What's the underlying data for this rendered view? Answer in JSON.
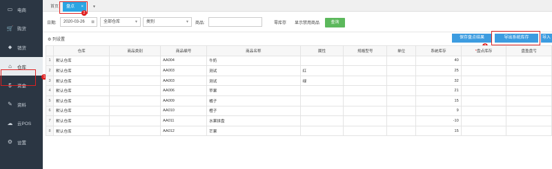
{
  "sidebar": {
    "items": [
      {
        "label": "电商",
        "icon": "monitor-icon",
        "glyph": "▭"
      },
      {
        "label": "购货",
        "icon": "cart-icon",
        "glyph": "🛒"
      },
      {
        "label": "销货",
        "icon": "tag-icon",
        "glyph": "⬥"
      },
      {
        "label": "仓库",
        "icon": "warehouse-icon",
        "glyph": "⌂"
      },
      {
        "label": "资金",
        "icon": "money-icon",
        "glyph": "$"
      },
      {
        "label": "资料",
        "icon": "pencil-icon",
        "glyph": "✎"
      },
      {
        "label": "云POS",
        "icon": "cloud-icon",
        "glyph": "☁"
      },
      {
        "label": "设置",
        "icon": "gear-icon",
        "glyph": "⚙"
      }
    ]
  },
  "tabs": {
    "home": "首页",
    "active": "盘点",
    "close": "×",
    "more": "▼"
  },
  "annotations": {
    "b1": "1",
    "b2": "2",
    "b3": "3"
  },
  "filter": {
    "date_label": "日期:",
    "date_value": "2020-03-26",
    "calendar_glyph": "▦",
    "warehouse_value": "全部仓库",
    "category_value": "类别",
    "dropdown_glyph": "▼",
    "product_label": "商品:",
    "product_value": "",
    "zero_stock": "零库存",
    "show_disabled": "显示禁用商品",
    "query_button": "查询"
  },
  "toolbar": {
    "column_settings": "⚙ 列设置",
    "save_button": "保存盘点结果",
    "export_button": "导出系统库存",
    "import_button": "导入"
  },
  "table": {
    "columns": [
      "",
      "仓库",
      "商品类别",
      "商品编号",
      "商品名称",
      "属性",
      "规格型号",
      "单位",
      "系统库存",
      "盘点库存",
      "盘盈盘亏"
    ],
    "required_mark": "*",
    "rows": [
      [
        "1",
        "默认仓库",
        "",
        "AA004",
        "牛奶",
        "",
        "",
        "",
        "40",
        "",
        ""
      ],
      [
        "2",
        "默认仓库",
        "",
        "AA003",
        "测试",
        "红",
        "",
        "",
        "25",
        "",
        ""
      ],
      [
        "3",
        "默认仓库",
        "",
        "AA003",
        "测试",
        "绿",
        "",
        "",
        "32",
        "",
        ""
      ],
      [
        "4",
        "默认仓库",
        "",
        "AA006",
        "苹果",
        "",
        "",
        "",
        "21",
        "",
        ""
      ],
      [
        "5",
        "默认仓库",
        "",
        "AA009",
        "橘子",
        "",
        "",
        "",
        "15",
        "",
        ""
      ],
      [
        "6",
        "默认仓库",
        "",
        "AA010",
        "橙子",
        "",
        "",
        "",
        "9",
        "",
        ""
      ],
      [
        "7",
        "默认仓库",
        "",
        "AA011",
        "水果拼盘",
        "",
        "",
        "",
        "-10",
        "",
        ""
      ],
      [
        "8",
        "默认仓库",
        "",
        "AA012",
        "芒果",
        "",
        "",
        "",
        "15",
        "",
        ""
      ]
    ]
  },
  "colors": {
    "sidebar": "#2b3643",
    "accent": "#2aa5e3",
    "button": "#3c9ce0",
    "query": "#5cb85c",
    "highlight": "#e02020"
  }
}
